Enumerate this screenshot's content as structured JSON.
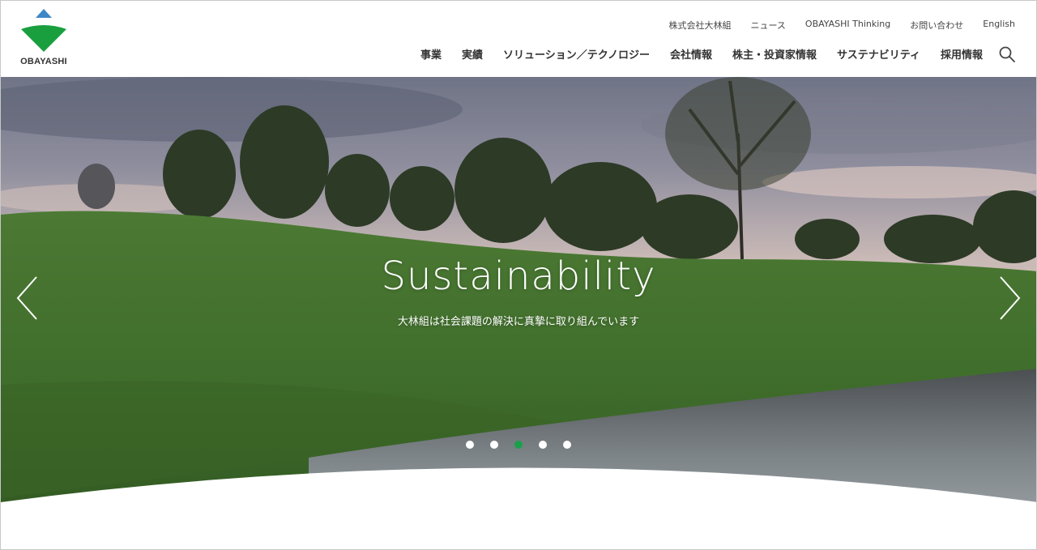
{
  "brand": {
    "name": "OBAYASHI",
    "colors": {
      "triangle_top": "#3f88c8",
      "triangle_bottom": "#1a9f3f"
    }
  },
  "util_nav": [
    {
      "label": "株式会社大林組"
    },
    {
      "label": "ニュース"
    },
    {
      "label": "OBAYASHI Thinking"
    },
    {
      "label": "お問い合わせ"
    },
    {
      "label": "English"
    }
  ],
  "main_nav": [
    {
      "label": "事業"
    },
    {
      "label": "実績"
    },
    {
      "label": "ソリューション／テクノロジー"
    },
    {
      "label": "会社情報"
    },
    {
      "label": "株主・投資家情報"
    },
    {
      "label": "サステナビリティ"
    },
    {
      "label": "採用情報"
    }
  ],
  "search": {
    "icon": "search-icon"
  },
  "hero": {
    "title": "Sustainability",
    "subtitle": "大林組は社会課題の解決に真摯に取り組んでいます",
    "slide_count": 5,
    "active_slide": 3,
    "active_color": "#1aa04a"
  }
}
